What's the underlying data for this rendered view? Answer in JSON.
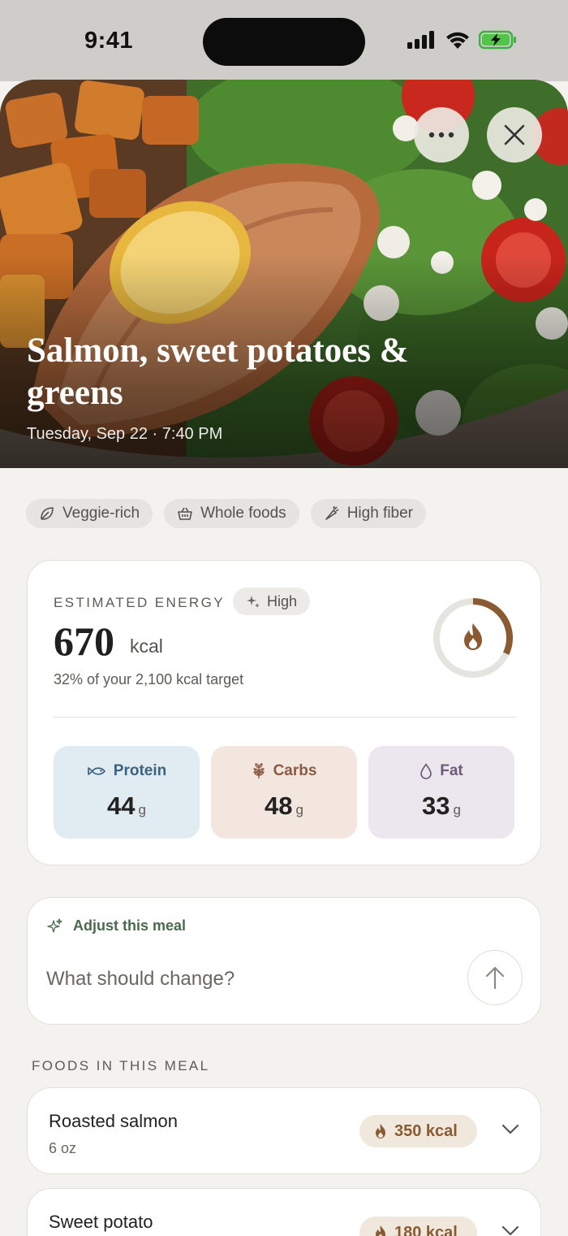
{
  "status_bar": {
    "time": "9:41"
  },
  "meal": {
    "title": "Salmon, sweet potatoes & greens",
    "date": "Tuesday, Sep 22 · 7:40 PM"
  },
  "tags": [
    {
      "label": "Veggie-rich",
      "icon": "leaf-icon"
    },
    {
      "label": "Whole foods",
      "icon": "basket-icon"
    },
    {
      "label": "High fiber",
      "icon": "carrot-icon"
    }
  ],
  "energy": {
    "label": "ESTIMATED ENERGY",
    "confidence": "High",
    "value": "670",
    "unit": "kcal",
    "target_text": "32% of your 2,100 kcal target",
    "progress_fraction": 0.32
  },
  "macros": {
    "protein": {
      "label": "Protein",
      "value": "44",
      "unit": "g"
    },
    "carbs": {
      "label": "Carbs",
      "value": "48",
      "unit": "g"
    },
    "fat": {
      "label": "Fat",
      "value": "33",
      "unit": "g"
    }
  },
  "adjust": {
    "title": "Adjust this meal",
    "placeholder": "What should change?"
  },
  "foods_section": {
    "title": "FOODS IN THIS MEAL"
  },
  "foods": [
    {
      "name": "Roasted salmon",
      "amount": "6 oz",
      "kcal": "350 kcal"
    },
    {
      "name": "Sweet potato",
      "amount": "",
      "kcal": "180 kcal"
    }
  ],
  "colors": {
    "background": "#f4f2ee",
    "accent_brown": "#8a5a32",
    "accent_green": "#4a6a4d",
    "protein_bg": "#e1ebf2",
    "carbs_bg": "#f3e6de",
    "fat_bg": "#ece6ee"
  }
}
